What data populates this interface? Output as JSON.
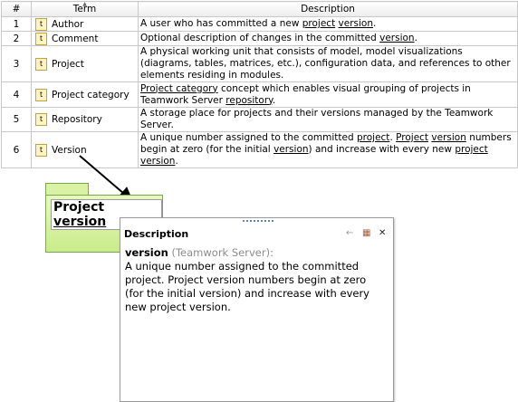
{
  "table": {
    "headers": {
      "num": "#",
      "term": "Term",
      "description": "Description"
    },
    "term_icon_glyph": "t",
    "rows": [
      {
        "num": "1",
        "term": "Author",
        "desc": [
          {
            "t": "A user who has committed a new "
          },
          {
            "t": "project",
            "u": true
          },
          {
            "t": " "
          },
          {
            "t": "version",
            "u": true
          },
          {
            "t": "."
          }
        ]
      },
      {
        "num": "2",
        "term": "Comment",
        "desc": [
          {
            "t": "Optional description of changes in the committed "
          },
          {
            "t": "version",
            "u": true
          },
          {
            "t": "."
          }
        ]
      },
      {
        "num": "3",
        "term": "Project",
        "desc": [
          {
            "t": "A physical working unit that consists of model, model visualizations (diagrams, tables, matrices, etc.), configuration data, and references to other elements residing in modules."
          }
        ]
      },
      {
        "num": "4",
        "term": "Project category",
        "desc": [
          {
            "t": "Project category",
            "u": true
          },
          {
            "t": " concept which enables visual grouping of projects in Teamwork Server "
          },
          {
            "t": "repository",
            "u": true
          },
          {
            "t": "."
          }
        ]
      },
      {
        "num": "5",
        "term": "Repository",
        "desc": [
          {
            "t": "A storage place for projects and their versions managed by the Teamwork Server."
          }
        ]
      },
      {
        "num": "6",
        "term": "Version",
        "desc": [
          {
            "t": "A unique number assigned to the committed "
          },
          {
            "t": "project",
            "u": true
          },
          {
            "t": ". "
          },
          {
            "t": "Project",
            "u": true
          },
          {
            "t": " "
          },
          {
            "t": "version",
            "u": true
          },
          {
            "t": " numbers begin at zero (for the initial "
          },
          {
            "t": "version",
            "u": true
          },
          {
            "t": ") and increase with every new "
          },
          {
            "t": "project",
            "u": true
          },
          {
            "t": " "
          },
          {
            "t": "version",
            "u": true
          },
          {
            "t": "."
          }
        ]
      }
    ]
  },
  "package": {
    "title_plain": "Project ",
    "title_underlined": "version"
  },
  "popup": {
    "title": "Description",
    "buttons": {
      "back": "←",
      "table": "▦",
      "close": "✕"
    },
    "keyword": "version",
    "source": " (Teamwork Server):",
    "text": "A unique number assigned to the committed project. Project version numbers begin at zero (for the initial version) and increase with every new project version."
  },
  "colors": {
    "grid": "#c9c9c9",
    "package_fill": "#d6f1a0",
    "package_border": "#7aa84a",
    "grip": "#5b87c4"
  }
}
